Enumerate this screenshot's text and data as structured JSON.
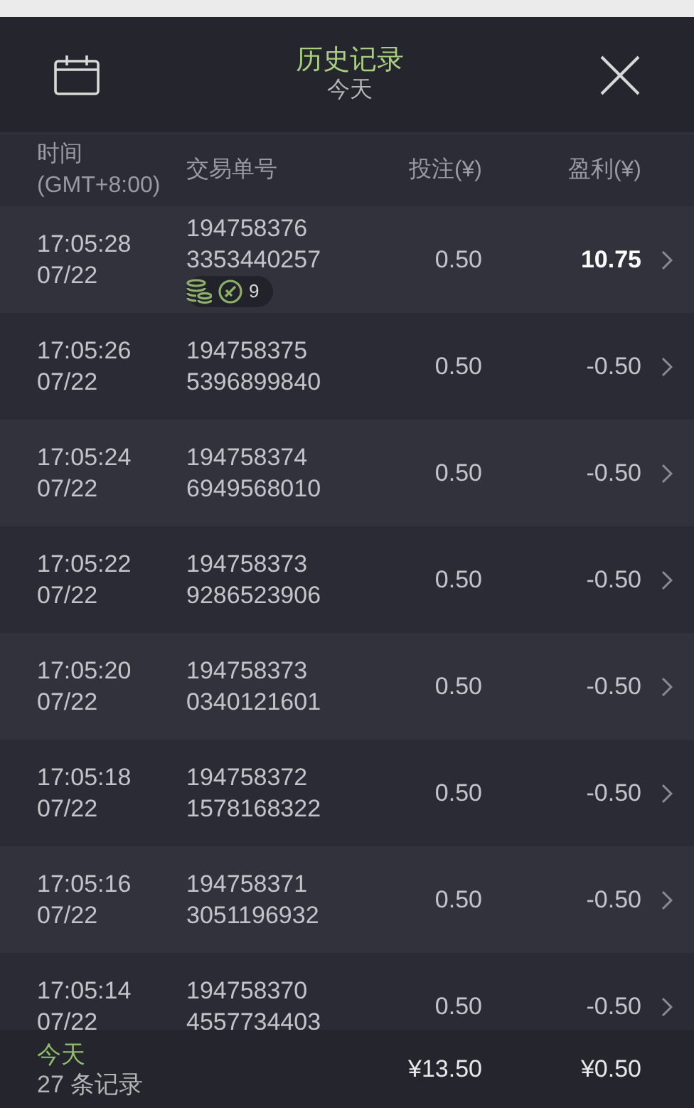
{
  "header": {
    "title": "历史记录",
    "subtitle": "今天"
  },
  "columns": [
    {
      "line1": "时间",
      "line2": "(GMT+8:00)"
    },
    {
      "line1": "交易单号"
    },
    {
      "line1": "投注(¥)"
    },
    {
      "line1": "盈利(¥)"
    }
  ],
  "rows": [
    {
      "time": "17:05:28",
      "date": "07/22",
      "id_1": "194758376",
      "id_2": "3353440257",
      "stake": "0.50",
      "profit": "10.75",
      "won": true,
      "badge": "9"
    },
    {
      "time": "17:05:26",
      "date": "07/22",
      "id_1": "194758375",
      "id_2": "5396899840",
      "stake": "0.50",
      "profit": "-0.50",
      "won": false
    },
    {
      "time": "17:05:24",
      "date": "07/22",
      "id_1": "194758374",
      "id_2": "6949568010",
      "stake": "0.50",
      "profit": "-0.50",
      "won": false
    },
    {
      "time": "17:05:22",
      "date": "07/22",
      "id_1": "194758373",
      "id_2": "9286523906",
      "stake": "0.50",
      "profit": "-0.50",
      "won": false
    },
    {
      "time": "17:05:20",
      "date": "07/22",
      "id_1": "194758373",
      "id_2": "0340121601",
      "stake": "0.50",
      "profit": "-0.50",
      "won": false
    },
    {
      "time": "17:05:18",
      "date": "07/22",
      "id_1": "194758372",
      "id_2": "1578168322",
      "stake": "0.50",
      "profit": "-0.50",
      "won": false
    },
    {
      "time": "17:05:16",
      "date": "07/22",
      "id_1": "194758371",
      "id_2": "3051196932",
      "stake": "0.50",
      "profit": "-0.50",
      "won": false
    },
    {
      "time": "17:05:14",
      "date": "07/22",
      "id_1": "194758370",
      "id_2": "4557734403",
      "stake": "0.50",
      "profit": "-0.50",
      "won": false
    }
  ],
  "footer": {
    "period": "今天",
    "count": "27 条记录",
    "total_stake": "¥13.50",
    "total_profit": "¥0.50"
  }
}
